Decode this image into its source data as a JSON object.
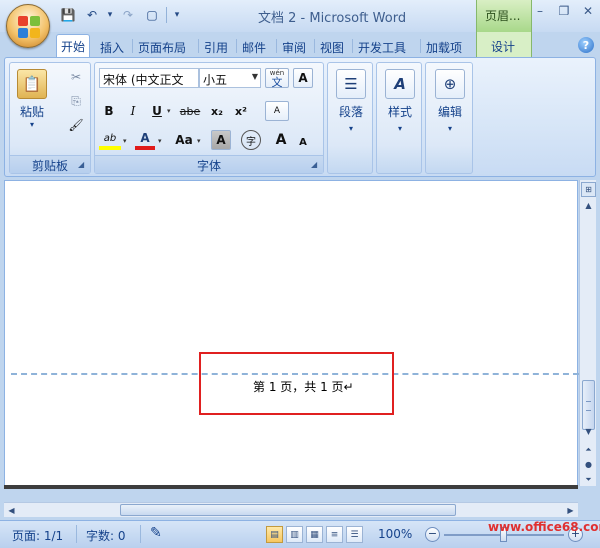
{
  "window": {
    "title": "文档 2 - Microsoft Word",
    "context_tab_group": "页眉...",
    "controls": {
      "minimize": "–",
      "restore": "❐",
      "close": "✕"
    }
  },
  "quick_access": {
    "save": "💾",
    "undo": "↶",
    "undo_arrow": "▾",
    "redo": "↷",
    "new": "▢",
    "customize": "▾"
  },
  "tabs": [
    {
      "label": "开始",
      "active": true
    },
    {
      "label": "插入"
    },
    {
      "label": "页面布局"
    },
    {
      "label": "引用"
    },
    {
      "label": "邮件"
    },
    {
      "label": "审阅"
    },
    {
      "label": "视图"
    },
    {
      "label": "开发工具"
    },
    {
      "label": "加载项"
    }
  ],
  "context_tab": {
    "label": "设计"
  },
  "help": "?",
  "ribbon": {
    "clipboard": {
      "label": "剪贴板",
      "paste": "粘贴",
      "paste_arrow": "▾",
      "cut_icon": "✂",
      "copy_icon": "⎘",
      "format_painter_icon": "🖌"
    },
    "font": {
      "label": "字体",
      "font_name": "宋体 (中文正文",
      "font_size": "小五",
      "phonetic_label": "wén",
      "phonetic_char": "文",
      "char_border": "A",
      "bold": "B",
      "italic": "I",
      "underline": "U",
      "strike": "abe",
      "subscript": "x₂",
      "superscript": "x²",
      "clear_format": "A",
      "highlight": "ab",
      "font_color": "A",
      "change_case": "Aa",
      "char_shading": "A",
      "enclose": "字",
      "grow": "A",
      "shrink": "A"
    },
    "paragraph": {
      "label": "段落",
      "arrow": "▾"
    },
    "styles": {
      "label": "样式",
      "arrow": "▾"
    },
    "editing": {
      "label": "编辑",
      "arrow": "▾"
    }
  },
  "document": {
    "header_text": "第 1 页，共 1 页↵"
  },
  "status": {
    "page": "页面: 1/1",
    "words": "字数: 0",
    "zoom": "100%"
  },
  "watermark": "www.office68.com",
  "colors": {
    "accent": "#15428b",
    "highlight_box": "#e02020",
    "header_line": "#8fb3d9"
  }
}
